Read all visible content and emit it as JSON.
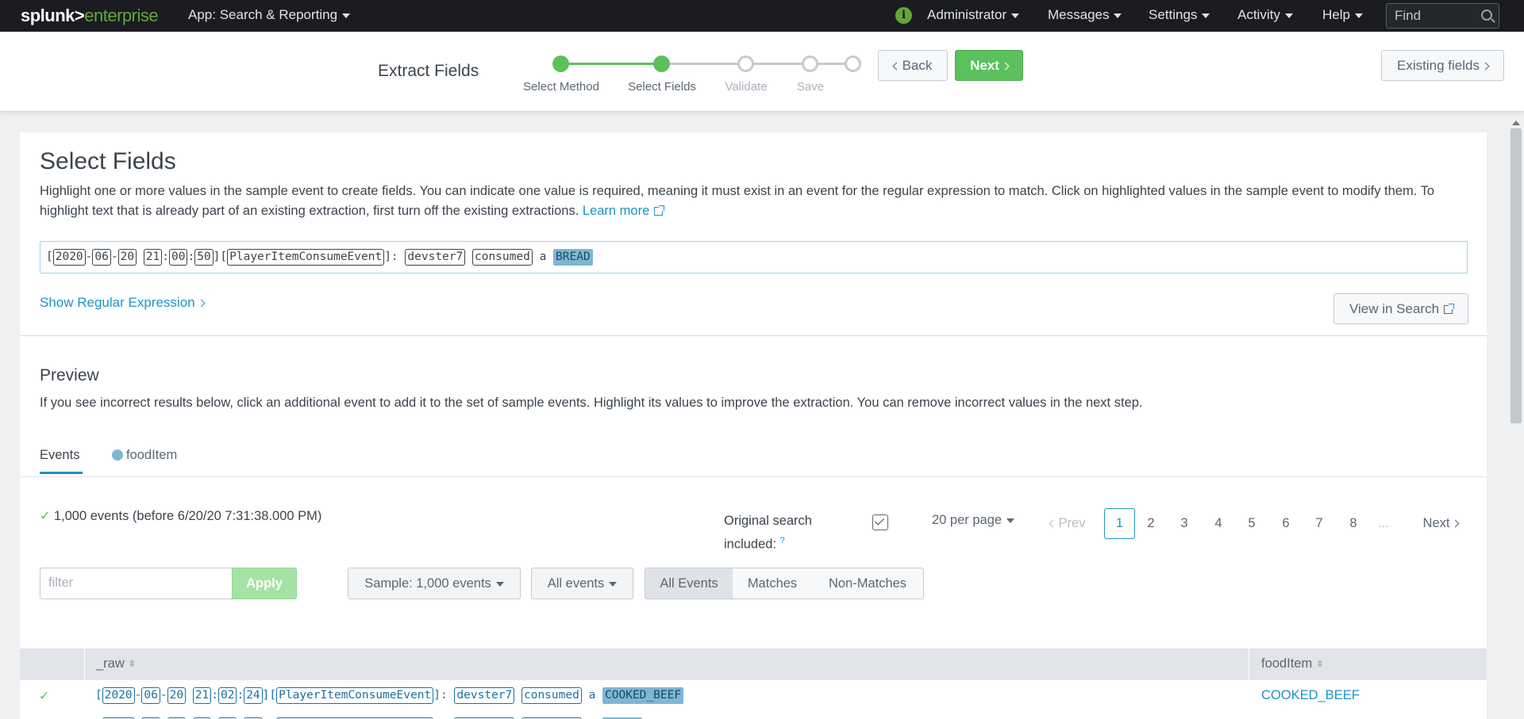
{
  "topnav": {
    "logo_main": "splunk>",
    "logo_sub": "enterprise",
    "app_menu": "App: Search & Reporting",
    "admin": "Administrator",
    "messages": "Messages",
    "settings": "Settings",
    "activity": "Activity",
    "help": "Help",
    "find_placeholder": "Find"
  },
  "wizard": {
    "title": "Extract Fields",
    "steps": [
      {
        "label": "Select Method",
        "state": "done"
      },
      {
        "label": "Select Fields",
        "state": "current"
      },
      {
        "label": "Validate",
        "state": "todo"
      },
      {
        "label": "Save",
        "state": "todo"
      },
      {
        "label": "",
        "state": "todo"
      }
    ],
    "back_label": "Back",
    "next_label": "Next",
    "existing_fields_label": "Existing fields"
  },
  "select_fields": {
    "title": "Select Fields",
    "intro": "Highlight one or more values in the sample event to create fields. You can indicate one value is required, meaning it must exist in an event for the regular expression to match. Click on highlighted values in the sample event to modify them. To highlight text that is already part of an existing extraction, first turn off the existing extractions.",
    "learn_more": "Learn more",
    "sample_event": {
      "year": "2020",
      "month": "06",
      "day": "20",
      "hour": "21",
      "minute": "00",
      "second": "50",
      "event_type": "PlayerItemConsumeEvent",
      "player": "devster7",
      "action": "consumed",
      "article": "a",
      "item": "BREAD"
    },
    "show_regex": "Show Regular Expression",
    "view_in_search": "View in Search"
  },
  "preview": {
    "title": "Preview",
    "description": "If you see incorrect results below, click an additional event to add it to the set of sample events. Highlight its values to improve the extraction. You can remove incorrect values in the next step.",
    "tabs": {
      "events": "Events",
      "field": "foodItem"
    },
    "event_count": "1,000 events (before 6/20/20 7:31:38.000 PM)",
    "original_search": "Original search included:",
    "original_search_help": "?",
    "per_page": "20 per page",
    "pager": {
      "prev": "Prev",
      "pages": [
        "1",
        "2",
        "3",
        "4",
        "5",
        "6",
        "7",
        "8"
      ],
      "ellipsis": "...",
      "next": "Next",
      "current": "1"
    },
    "filter_placeholder": "filter",
    "apply": "Apply",
    "sample_dropdown": "Sample: 1,000 events",
    "all_events_dropdown": "All events",
    "segments": [
      "All Events",
      "Matches",
      "Non-Matches"
    ],
    "table": {
      "col_raw": "_raw",
      "col_food": "foodItem",
      "rows": [
        {
          "year": "2020",
          "month": "06",
          "day": "20",
          "hour": "21",
          "minute": "02",
          "second": "24",
          "event_type": "PlayerItemConsumeEvent",
          "player": "devster7",
          "action": "consumed",
          "article": "a",
          "item": "COOKED_BEEF",
          "foodItem": "COOKED_BEEF"
        }
      ]
    }
  },
  "colors": {
    "accent": "#1e93c6",
    "success": "#5cc05c",
    "highlight": "#7eb6d3",
    "nav_bg": "#1a1c21"
  }
}
